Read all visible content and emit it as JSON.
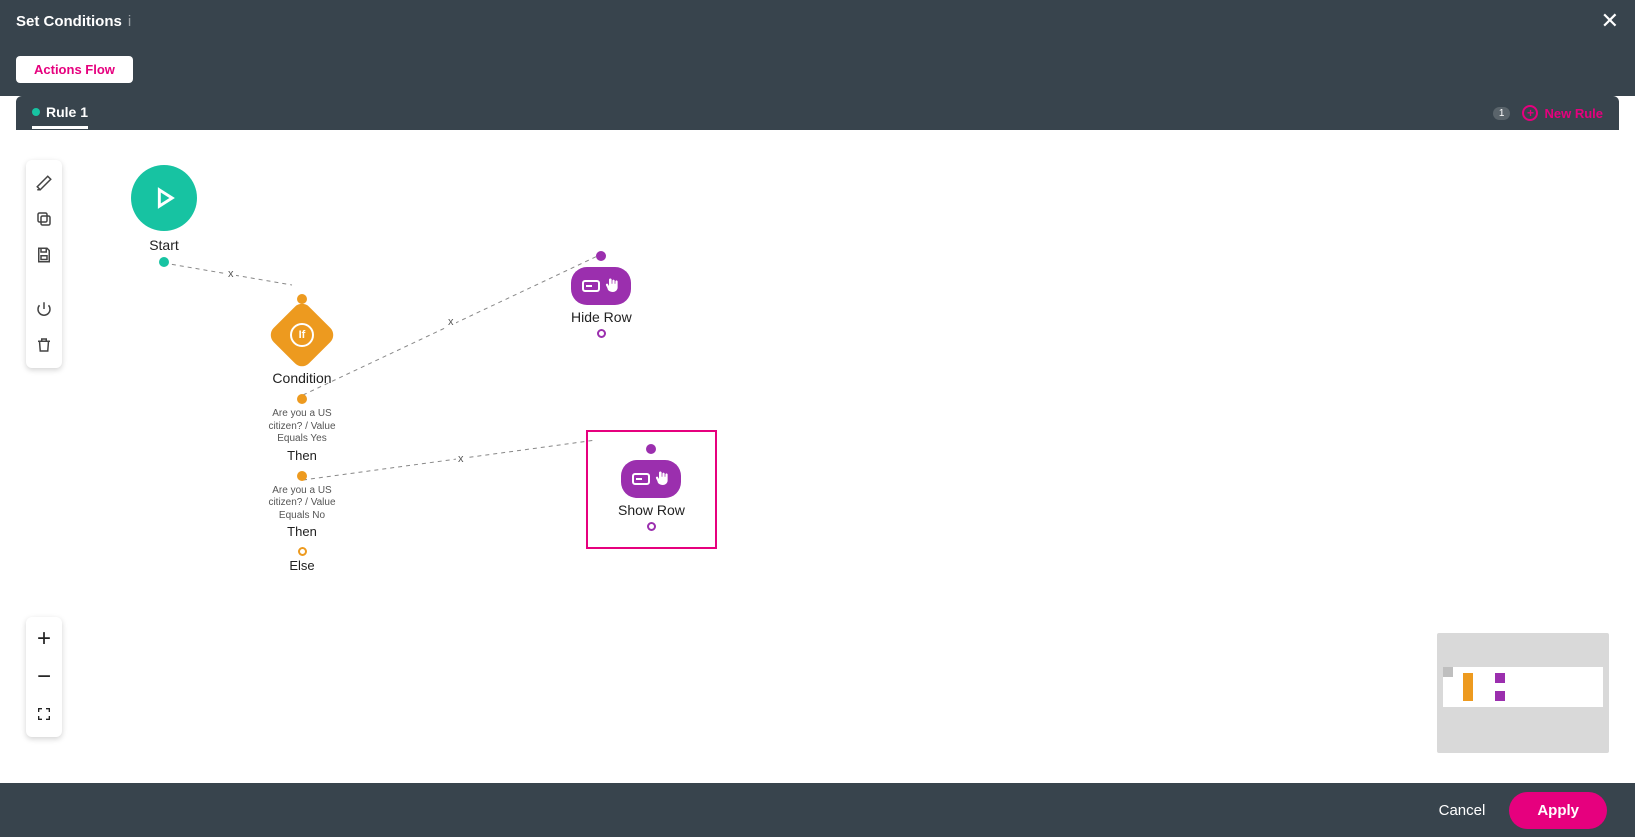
{
  "header": {
    "title": "Set Conditions",
    "hint": "i"
  },
  "subheader": {
    "actions_flow": "Actions Flow"
  },
  "tabs": {
    "rule1": "Rule 1",
    "new_rule": "New Rule",
    "count": "1"
  },
  "nodes": {
    "start": {
      "label": "Start"
    },
    "condition": {
      "if": "If",
      "label": "Condition",
      "branch1_desc": "Are you a US citizen? / Value Equals Yes",
      "branch1_then": "Then",
      "branch2_desc": "Are you a US citizen? / Value Equals No",
      "branch2_then": "Then",
      "else": "Else"
    },
    "hide_row": {
      "label": "Hide Row"
    },
    "show_row": {
      "label": "Show Row"
    }
  },
  "edges": {
    "x": "x"
  },
  "footer": {
    "cancel": "Cancel",
    "apply": "Apply"
  }
}
